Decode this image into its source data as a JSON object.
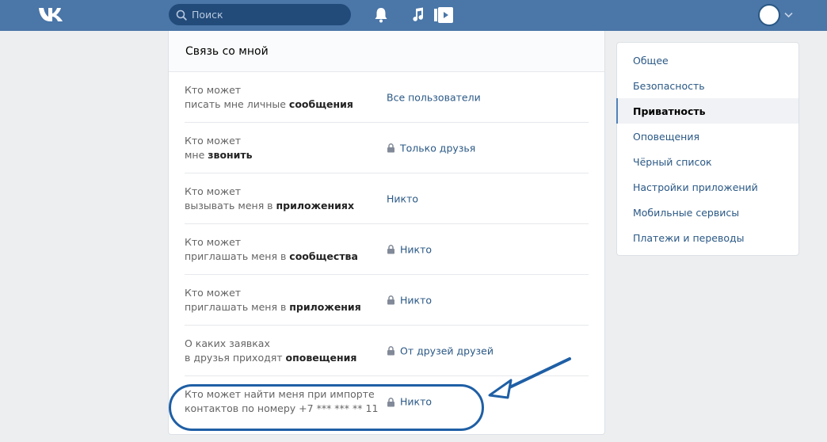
{
  "header": {
    "logo_icon": "vk-logo-icon",
    "search_placeholder": "Поиск",
    "icons": [
      "bell-icon",
      "music-icon",
      "video-icon"
    ]
  },
  "card": {
    "title": "Связь со мной",
    "rows": [
      {
        "line1": "Кто может",
        "line2_plain": "писать мне личные ",
        "line2_bold": "сообщения",
        "value": "Все пользователи",
        "locked": false
      },
      {
        "line1": "Кто может",
        "line2_plain": "мне ",
        "line2_bold": "звонить",
        "value": "Только друзья",
        "locked": true
      },
      {
        "line1": "Кто может",
        "line2_plain": "вызывать меня в ",
        "line2_bold": "приложениях",
        "value": "Никто",
        "locked": false
      },
      {
        "line1": "Кто может",
        "line2_plain": "приглашать меня в ",
        "line2_bold": "сообщества",
        "value": "Никто",
        "locked": true
      },
      {
        "line1": "Кто может",
        "line2_plain": "приглашать меня в ",
        "line2_bold": "приложения",
        "value": "Никто",
        "locked": true
      },
      {
        "line1": "О каких заявках",
        "line2_plain": "в друзья приходят ",
        "line2_bold": "оповещения",
        "value": "От друзей друзей",
        "locked": true
      },
      {
        "line1": "Кто может найти меня при импорте",
        "line2_plain": "контактов по номеру +7 *** *** ** 11",
        "line2_bold": "",
        "value": "Никто",
        "locked": true
      }
    ]
  },
  "menu": {
    "items": [
      {
        "label": "Общее",
        "active": false
      },
      {
        "label": "Безопасность",
        "active": false
      },
      {
        "label": "Приватность",
        "active": true
      },
      {
        "label": "Оповещения",
        "active": false
      },
      {
        "label": "Чёрный список",
        "active": false
      },
      {
        "label": "Настройки приложений",
        "active": false
      },
      {
        "label": "Мобильные сервисы",
        "active": false
      },
      {
        "label": "Платежи и переводы",
        "active": false
      }
    ]
  },
  "colors": {
    "header_bg": "#4a76a8",
    "link": "#2a5885",
    "annotation": "#1f5fa5"
  }
}
